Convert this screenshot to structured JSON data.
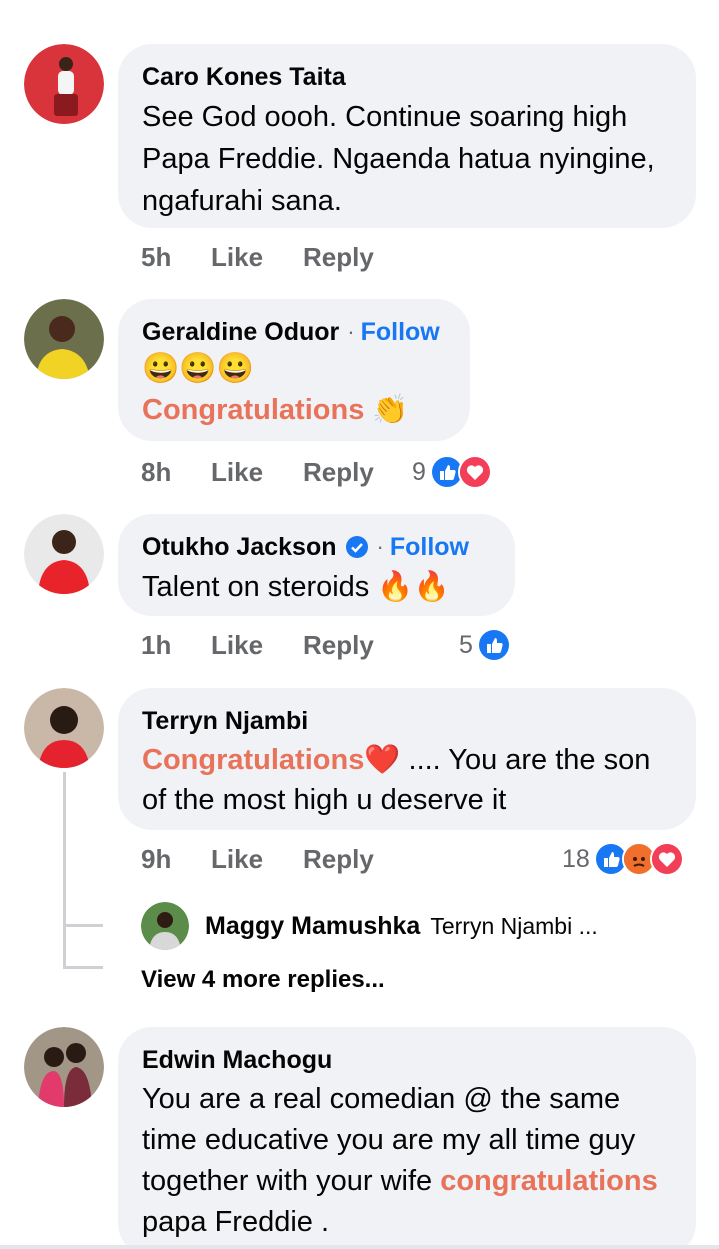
{
  "comments": [
    {
      "author": "Caro Kones Taita",
      "text": "See God oooh. Continue soaring high Papa Freddie. Ngaenda hatua nyingine, ngafurahi sana.",
      "time": "5h",
      "like": "Like",
      "reply": "Reply"
    },
    {
      "author": "Geraldine Oduor",
      "follow": "Follow",
      "emojis": "😀😀😀",
      "highlight": "Congratulations",
      "emoji_after": "👏",
      "time": "8h",
      "like": "Like",
      "reply": "Reply",
      "reaction_count": "9"
    },
    {
      "author": "Otukho Jackson",
      "follow": "Follow",
      "text": "Talent on steroids",
      "emoji_after": "🔥🔥",
      "time": "1h",
      "like": "Like",
      "reply": "Reply",
      "reaction_count": "5"
    },
    {
      "author": "Terryn Njambi",
      "highlight": "Congratulations",
      "emoji_heart": "❤️",
      "text": " .... You are the son of the most high u deserve it",
      "time": "9h",
      "like": "Like",
      "reply": "Reply",
      "reaction_count": "18",
      "reply_preview": {
        "author": "Maggy Mamushka",
        "text": "Terryn Njambi ..."
      },
      "more_replies": "View 4 more replies..."
    },
    {
      "author": "Edwin Machogu",
      "text": "You are a real comedian @ the same time educative you are my all time guy together with your wife",
      "highlight": "congratulations",
      "text_after": " papa Freddie ."
    }
  ],
  "colors": {
    "bubble": "#f0f2f5",
    "follow": "#1877f2",
    "highlight": "#e8735a",
    "meta": "#65676b"
  },
  "icons": [
    "verified-badge-icon",
    "like-reaction-icon",
    "love-reaction-icon",
    "angry-reaction-icon"
  ]
}
